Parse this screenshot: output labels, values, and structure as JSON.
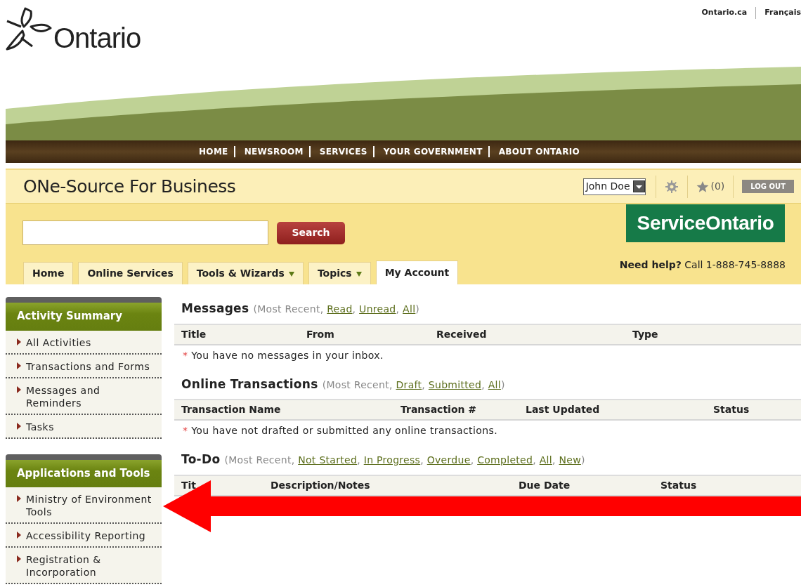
{
  "top_links": [
    {
      "label": "Ontario.ca"
    },
    {
      "label": "Français"
    }
  ],
  "logo": {
    "text": "Ontario"
  },
  "main_nav": [
    {
      "label": "HOME"
    },
    {
      "label": "NEWSROOM"
    },
    {
      "label": "SERVICES"
    },
    {
      "label": "YOUR GOVERNMENT"
    },
    {
      "label": "ABOUT ONTARIO"
    }
  ],
  "app_bar": {
    "title": "ONe-Source For Business",
    "user": "John Doe",
    "favorites": "(0)",
    "logout": "LOG OUT"
  },
  "search": {
    "button": "Search"
  },
  "brand": "ServiceOntario",
  "help": {
    "label": "Need help?",
    "text": " Call 1-888-745-8888"
  },
  "tabs": [
    {
      "label": "Home",
      "selected": false,
      "dropdown": false
    },
    {
      "label": "Online Services",
      "selected": false,
      "dropdown": false
    },
    {
      "label": "Tools & Wizards",
      "selected": false,
      "dropdown": true
    },
    {
      "label": "Topics",
      "selected": false,
      "dropdown": true
    },
    {
      "label": "My Account",
      "selected": true,
      "dropdown": false
    }
  ],
  "sidebar": [
    {
      "title": "Activity Summary",
      "items": [
        "All Activities",
        "Transactions and Forms",
        "Messages and Reminders",
        "Tasks"
      ]
    },
    {
      "title": "Applications and Tools",
      "items": [
        "Ministry of Environment Tools",
        "Accessibility Reporting",
        "Registration & Incorporation"
      ]
    }
  ],
  "sections": [
    {
      "title": "Messages",
      "filters": [
        {
          "text": "(Most Recent, ",
          "link": false
        },
        {
          "text": "Read",
          "link": true
        },
        {
          "text": ", ",
          "link": false
        },
        {
          "text": "Unread",
          "link": true
        },
        {
          "text": ", ",
          "link": false
        },
        {
          "text": "All",
          "link": true
        },
        {
          "text": ")",
          "link": false
        }
      ],
      "columns": [
        "Title",
        "From",
        "Received",
        "Type"
      ],
      "empty": {
        "marker": "*",
        "text": " You have no messages in your inbox."
      }
    },
    {
      "title": "Online Transactions",
      "filters": [
        {
          "text": "(Most Recent, ",
          "link": false
        },
        {
          "text": "Draft",
          "link": true
        },
        {
          "text": ", ",
          "link": false
        },
        {
          "text": "Submitted",
          "link": true
        },
        {
          "text": ", ",
          "link": false
        },
        {
          "text": "All",
          "link": true
        },
        {
          "text": ")",
          "link": false
        }
      ],
      "columns": [
        "Transaction Name",
        "Transaction #",
        "Last Updated",
        "Status"
      ],
      "empty": {
        "marker": "*",
        "text": " You have not drafted or submitted any online transactions."
      }
    },
    {
      "title": "To-Do",
      "filters": [
        {
          "text": "(Most Recent, ",
          "link": false
        },
        {
          "text": "Not Started",
          "link": true
        },
        {
          "text": ", ",
          "link": false
        },
        {
          "text": "In Progress",
          "link": true
        },
        {
          "text": ", ",
          "link": false
        },
        {
          "text": "Overdue",
          "link": true
        },
        {
          "text": ", ",
          "link": false
        },
        {
          "text": "Completed",
          "link": true
        },
        {
          "text": ", ",
          "link": false
        },
        {
          "text": "All",
          "link": true
        },
        {
          "text": ", ",
          "link": false
        },
        {
          "text": "New",
          "link": true
        },
        {
          "text": ")",
          "link": false
        }
      ],
      "columns": [
        "Tit",
        "Description/Notes",
        "Due Date",
        "Status"
      ]
    }
  ],
  "annotation": {
    "kind": "arrow"
  }
}
